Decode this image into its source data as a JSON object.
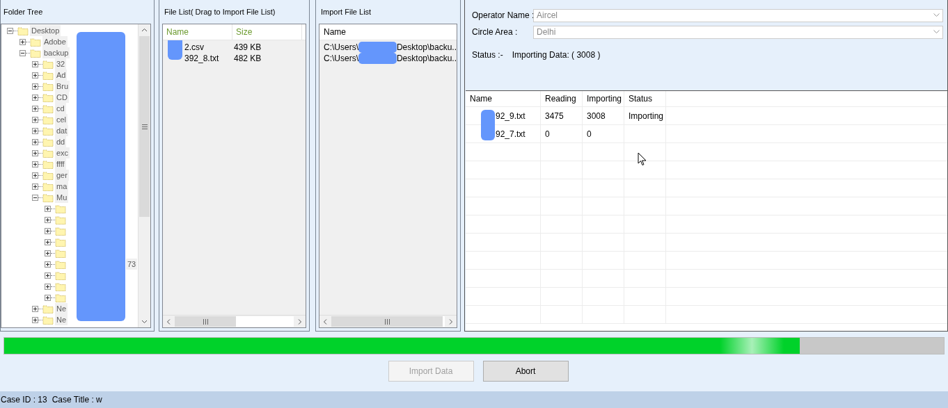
{
  "folder_tree": {
    "title": "Folder Tree",
    "items": [
      {
        "label": "Desktop",
        "expanded": true,
        "children": [
          {
            "label": "Adobe",
            "expanded": false
          },
          {
            "label": "backup",
            "expanded": true,
            "children": [
              {
                "label": "32",
                "expanded": false
              },
              {
                "label": "Ad",
                "expanded": false
              },
              {
                "label": "Bru",
                "expanded": false
              },
              {
                "label": "CD",
                "expanded": false
              },
              {
                "label": "cd",
                "expanded": false
              },
              {
                "label": "cel",
                "expanded": false
              },
              {
                "label": "dat",
                "expanded": false
              },
              {
                "label": "dd",
                "expanded": false
              },
              {
                "label": "exc",
                "expanded": false
              },
              {
                "label": "ffff",
                "expanded": false
              },
              {
                "label": "ger",
                "expanded": false
              },
              {
                "label": "ma",
                "expanded": false
              },
              {
                "label": "Mu",
                "expanded": true,
                "children": [
                  {
                    "expanded": false
                  },
                  {
                    "expanded": false
                  },
                  {
                    "expanded": false
                  },
                  {
                    "expanded": false
                  },
                  {
                    "expanded": false
                  },
                  {
                    "label": "73",
                    "expanded": false
                  },
                  {
                    "expanded": false
                  },
                  {
                    "expanded": false
                  },
                  {
                    "expanded": false
                  }
                ]
              },
              {
                "label": "Ne",
                "expanded": false
              },
              {
                "label": "Ne",
                "expanded": false
              }
            ]
          }
        ]
      }
    ]
  },
  "file_list": {
    "title": "File List( Drag to Import File List)",
    "columns": [
      "Name",
      "Size"
    ],
    "rows": [
      {
        "name": "2.csv",
        "size": "439 KB"
      },
      {
        "name": "392_8.txt",
        "size": "482 KB"
      }
    ]
  },
  "import_file_list": {
    "title": "Import File List",
    "columns": [
      "Name"
    ],
    "rows": [
      {
        "path_start": "C:\\Users\\",
        "path_end": "Desktop\\backu.."
      },
      {
        "path_start": "C:\\Users\\",
        "path_end": "Desktop\\backu.."
      }
    ]
  },
  "settings": {
    "operator_label": "Operator Name :",
    "operator_value": "Aircel",
    "circle_label": "Circle Area :",
    "circle_value": "Delhi",
    "status_label": "Status :-",
    "status_value": "Importing Data: ( 3008 )"
  },
  "import_table": {
    "columns": [
      "Name",
      "Reading",
      "Importing",
      "Status"
    ],
    "rows": [
      {
        "name": "92_9.txt",
        "reading": "3475",
        "importing": "3008",
        "status": "Importing"
      },
      {
        "name": "92_7.txt",
        "reading": "0",
        "importing": "0"
      }
    ]
  },
  "progress": {
    "level": 0.847
  },
  "buttons": [
    {
      "label": "Import Data",
      "disabled": true
    },
    {
      "label": "Abort",
      "disabled": false
    }
  ],
  "status_bar": {
    "case_id": "Case ID : 13",
    "case_title": "Case Title : w"
  }
}
